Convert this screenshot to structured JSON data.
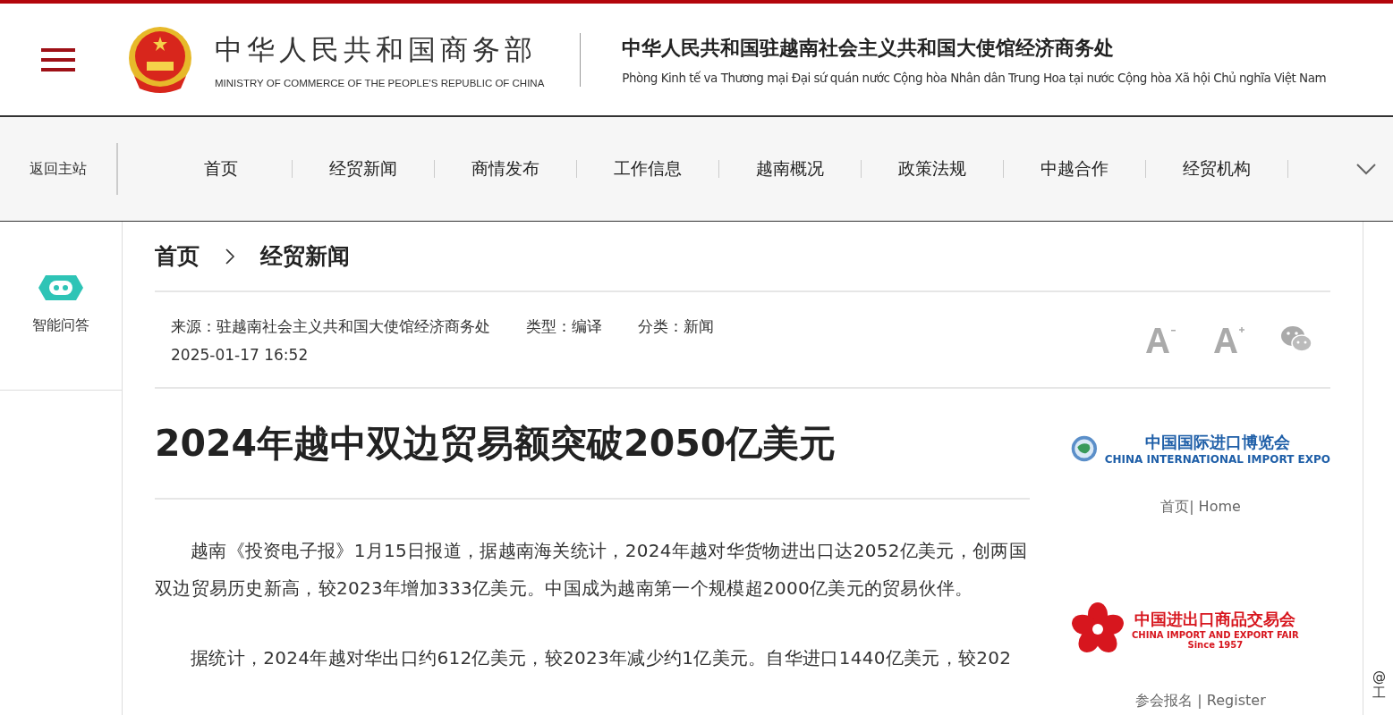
{
  "header": {
    "ministry_cn": "中华人民共和国商务部",
    "ministry_en": "MINISTRY OF COMMERCE OF THE PEOPLE'S REPUBLIC OF CHINA",
    "office_cn": "中华人民共和国驻越南社会主义共和国大使馆经济商务处",
    "office_vi": "Phòng Kinh tế va Thương mại Đại sứ quán nước Cộng hòa Nhân dân Trung Hoa tại nước Cộng hòa Xã hội Chủ nghĩa Việt Nam"
  },
  "nav": {
    "back": "返回主站",
    "items": [
      {
        "label": "首页"
      },
      {
        "label": "经贸新闻"
      },
      {
        "label": "商情发布"
      },
      {
        "label": "工作信息"
      },
      {
        "label": "越南概况"
      },
      {
        "label": "政策法规"
      },
      {
        "label": "中越合作"
      },
      {
        "label": "经贸机构"
      }
    ]
  },
  "sidebar": {
    "assistant": "智能问答"
  },
  "breadcrumb": [
    "首页",
    "经贸新闻"
  ],
  "meta": {
    "source": "来源：驻越南社会主义共和国大使馆经济商务处",
    "type": "类型：编译",
    "category": "分类：新闻",
    "date": "2025-01-17 16:52"
  },
  "article": {
    "title": "2024年越中双边贸易额突破2050亿美元",
    "paragraphs": [
      "越南《投资电子报》1月15日报道，据越南海关统计，2024年越对华货物进出口达2052亿美元，创两国双边贸易历史新高，较2023年增加333亿美元。中国成为越南第一个规模超2000亿美元的贸易伙伴。",
      "据统计，2024年越对华出口约612亿美元，较2023年减少约1亿美元。自华进口1440亿美元，较202"
    ]
  },
  "ads": [
    {
      "kind": "ciie",
      "logo_cn": "中国国际进口博览会",
      "logo_en": "CHINA INTERNATIONAL IMPORT EXPO",
      "link": "首页| Home"
    },
    {
      "kind": "fair",
      "logo_cn": "中国进出口商品交易会",
      "logo_en": "CHINA IMPORT AND EXPORT FAIR",
      "since": "Since 1957",
      "link": "参会报名 | Register"
    }
  ],
  "edge": [
    "@",
    "工"
  ]
}
